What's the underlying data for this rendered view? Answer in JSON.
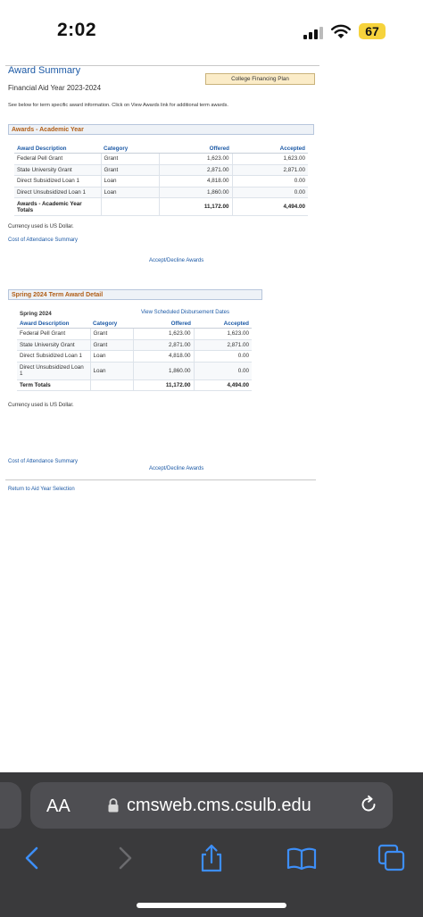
{
  "status_bar": {
    "time": "2:02",
    "battery": "67"
  },
  "header": {
    "title": "Award Summary",
    "aid_year": "Financial Aid Year 2023-2024",
    "cfp_button": "College Financing Plan",
    "instructions": "See below for term specific award information. Click on View Awards link for additional term awards."
  },
  "academic_year": {
    "section_title": "Awards - Academic Year",
    "columns": [
      "Award Description",
      "Category",
      "Offered",
      "Accepted"
    ],
    "rows": [
      {
        "desc": "Federal Pell Grant",
        "category": "Grant",
        "offered": "1,623.00",
        "accepted": "1,623.00"
      },
      {
        "desc": "State University Grant",
        "category": "Grant",
        "offered": "2,871.00",
        "accepted": "2,871.00"
      },
      {
        "desc": "Direct Subsidized Loan 1",
        "category": "Loan",
        "offered": "4,818.00",
        "accepted": "0.00"
      },
      {
        "desc": "Direct Unsubsidized Loan 1",
        "category": "Loan",
        "offered": "1,860.00",
        "accepted": "0.00"
      }
    ],
    "totals": {
      "label_line1": "Awards - Academic Year",
      "label_line2": "Totals",
      "offered": "11,172.00",
      "accepted": "4,494.00"
    },
    "currency_note": "Currency used is US Dollar.",
    "cost_link": "Cost of Attendance Summary",
    "accept_link": "Accept/Decline Awards"
  },
  "term": {
    "section_title": "Spring 2024 Term Award Detail",
    "schedule_link": "View Scheduled Disbursement Dates",
    "term_label": "Spring 2024",
    "columns": [
      "Award Description",
      "Category",
      "Offered",
      "Accepted"
    ],
    "rows": [
      {
        "desc": "Federal Pell Grant",
        "category": "Grant",
        "offered": "1,623.00",
        "accepted": "1,623.00"
      },
      {
        "desc": "State University Grant",
        "category": "Grant",
        "offered": "2,871.00",
        "accepted": "2,871.00"
      },
      {
        "desc": "Direct Subsidized Loan 1",
        "category": "Loan",
        "offered": "4,818.00",
        "accepted": "0.00"
      },
      {
        "desc_line1": "Direct Unsubsidized Loan",
        "desc_line2": "1",
        "category": "Loan",
        "offered": "1,860.00",
        "accepted": "0.00"
      }
    ],
    "totals": {
      "label": "Term Totals",
      "offered": "11,172.00",
      "accepted": "4,494.00"
    },
    "currency_note": "Currency used is US Dollar.",
    "cost_link": "Cost of Attendance Summary",
    "accept_link": "Accept/Decline Awards"
  },
  "footer": {
    "return_link": "Return to Aid Year Selection"
  },
  "browser": {
    "aa_label": "AA",
    "url": "cmsweb.cms.csulb.edu"
  }
}
